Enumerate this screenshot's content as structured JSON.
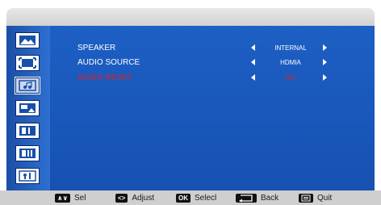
{
  "menu": {
    "rows": [
      {
        "label": "SPEAKER",
        "value": "INTERNAL"
      },
      {
        "label": "AUDIO SOURCE",
        "value": "HDMIA"
      },
      {
        "label": "AUDIO RESET",
        "value": "NO"
      }
    ]
  },
  "sidebar": {
    "items": [
      {
        "icon": "picture-icon"
      },
      {
        "icon": "screen-icon"
      },
      {
        "icon": "audio-icon",
        "selected": true
      },
      {
        "icon": "pip-icon"
      },
      {
        "icon": "setup-icon"
      },
      {
        "icon": "advanced-setup-icon"
      },
      {
        "icon": "information-icon"
      }
    ]
  },
  "footer": {
    "sel_key": "∧∨",
    "sel_label": "Sel",
    "adjust_key": "<>",
    "adjust_label": "Adjust",
    "ok_key": "OK",
    "ok_label": "Selecl",
    "back_label": "Back",
    "quit_label": "Quit"
  },
  "colors": {
    "menu_background": "#1d5fc4",
    "sidebar_background": "#1a4fa8",
    "reset_text": "#d8232a",
    "footer_background": "#cfcfcf"
  }
}
